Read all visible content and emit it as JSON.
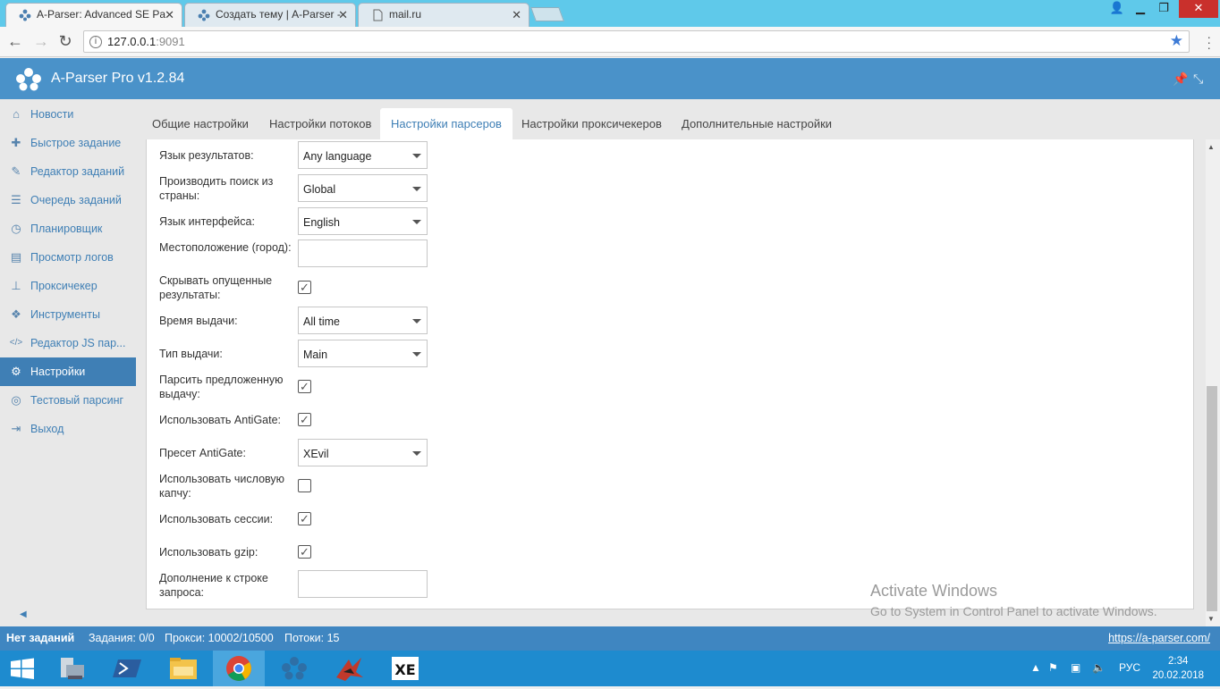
{
  "browser": {
    "tabs": [
      {
        "title": "A-Parser: Advanced SE Pa",
        "icon": "aparser-icon",
        "active": true
      },
      {
        "title": "Создать тему | A-Parser -",
        "icon": "aparser-icon",
        "active": false
      },
      {
        "title": "mail.ru",
        "icon": "page-icon",
        "active": false
      }
    ],
    "url_host": "127.0.0.1",
    "url_port": ":9091",
    "info_icon": "i"
  },
  "app": {
    "title": "A-Parser Pro v1.2.84"
  },
  "sidebar": {
    "items": [
      {
        "label": "Новости",
        "icon": "home-icon",
        "glyph": "⌂"
      },
      {
        "label": "Быстрое задание",
        "icon": "puzzle-icon",
        "glyph": "✚"
      },
      {
        "label": "Редактор заданий",
        "icon": "edit-icon",
        "glyph": "✎"
      },
      {
        "label": "Очередь заданий",
        "icon": "list-icon",
        "glyph": "☰"
      },
      {
        "label": "Планировщик",
        "icon": "clock-icon",
        "glyph": "◷"
      },
      {
        "label": "Просмотр логов",
        "icon": "file-icon",
        "glyph": "▤"
      },
      {
        "label": "Проксичекер",
        "icon": "sitemap-icon",
        "glyph": "⊥"
      },
      {
        "label": "Инструменты",
        "icon": "cubes-icon",
        "glyph": "❖"
      },
      {
        "label": "Редактор JS пар...",
        "icon": "code-icon",
        "glyph": "</>"
      },
      {
        "label": "Настройки",
        "icon": "gears-icon",
        "glyph": "⚙"
      },
      {
        "label": "Тестовый парсинг",
        "icon": "bullseye-icon",
        "glyph": "◎"
      },
      {
        "label": "Выход",
        "icon": "sign-out-icon",
        "glyph": "⇥"
      }
    ],
    "active_index": 9
  },
  "settings_tabs": [
    {
      "label": "Общие настройки",
      "active": false
    },
    {
      "label": "Настройки потоков",
      "active": false
    },
    {
      "label": "Настройки парсеров",
      "active": true
    },
    {
      "label": "Настройки проксичекеров",
      "active": false
    },
    {
      "label": "Дополнительные настройки",
      "active": false
    }
  ],
  "form": {
    "results_language": {
      "label": "Язык результатов:",
      "value": "Any language"
    },
    "search_country": {
      "label": "Производить поиск из страны:",
      "value": "Global"
    },
    "interface_language": {
      "label": "Язык интерфейса:",
      "value": "English"
    },
    "location": {
      "label": "Местоположение (город):",
      "value": ""
    },
    "hide_omitted": {
      "label": "Скрывать опущенные результаты:",
      "checked": true
    },
    "time_range": {
      "label": "Время выдачи:",
      "value": "All time"
    },
    "result_type": {
      "label": "Тип выдачи:",
      "value": "Main"
    },
    "parse_suggested": {
      "label": "Парсить предложенную выдачу:",
      "checked": true
    },
    "use_antigate": {
      "label": "Использовать AntiGate:",
      "checked": true
    },
    "antigate_preset": {
      "label": "Пресет AntiGate:",
      "value": "XEvil"
    },
    "numeric_captcha": {
      "label": "Использовать числовую капчу:",
      "checked": false
    },
    "use_sessions": {
      "label": "Использовать сессии:",
      "checked": true
    },
    "use_gzip": {
      "label": "Использовать gzip:",
      "checked": true
    },
    "query_suffix": {
      "label": "Дополнение к строке запроса:",
      "value": ""
    }
  },
  "watermark": {
    "line1": "Activate Windows",
    "line2": "Go to System in Control Panel to activate Windows."
  },
  "status": {
    "state": "Нет заданий",
    "tasks": "Задания: 0/0",
    "proxies": "Прокси: 10002/10500",
    "threads": "Потоки: 15",
    "link": "https://a-parser.com/"
  },
  "taskbar": {
    "lang": "РУС",
    "time": "2:34",
    "date": "20.02.2018"
  },
  "colors": {
    "header": "#4a92c9",
    "accent": "#3f7fb5",
    "statusbar": "#3f86c1",
    "taskbar": "#1e8bcf"
  }
}
